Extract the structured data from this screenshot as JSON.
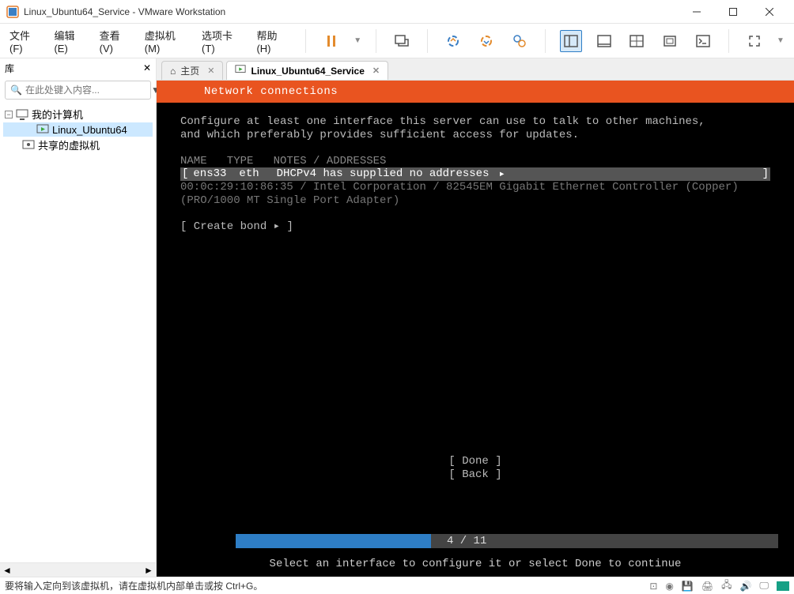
{
  "window": {
    "title": "Linux_Ubuntu64_Service - VMware Workstation"
  },
  "menu": {
    "file": "文件(F)",
    "edit": "编辑(E)",
    "view": "查看(V)",
    "vm": "虚拟机(M)",
    "tabs": "选项卡(T)",
    "help": "帮助(H)"
  },
  "sidebar": {
    "title": "库",
    "search_placeholder": "在此处键入内容...",
    "tree": {
      "root": "我的计算机",
      "child1": "Linux_Ubuntu64",
      "shared": "共享的虚拟机"
    }
  },
  "tabs": {
    "home": "主页",
    "active": "Linux_Ubuntu64_Service"
  },
  "installer": {
    "header": "Network connections",
    "intro1": "Configure at least one interface this server can use to talk to other machines,",
    "intro2": "and which preferably provides sufficient access for updates.",
    "col_headers": "NAME   TYPE   NOTES / ADDRESSES",
    "iface": {
      "open": "[",
      "name": "ens33",
      "type": "eth",
      "note": "DHCPv4 has supplied no addresses",
      "arrow": "▸",
      "close": "]"
    },
    "iface_detail1": "00:0c:29:10:86:35 / Intel Corporation / 82545EM Gigabit Ethernet Controller (Copper)",
    "iface_detail2": "(PRO/1000 MT Single Port Adapter)",
    "create_bond": "[ Create bond ▸ ]",
    "done_btn": "[ Done       ]",
    "back_btn": "[ Back       ]",
    "progress_text": "4 / 11",
    "bottom_hint": "Select an interface to configure it or select Done to continue"
  },
  "statusbar": {
    "msg": "要将输入定向到该虚拟机，请在虚拟机内部单击或按 Ctrl+G。"
  },
  "progress": {
    "percent": 36
  }
}
